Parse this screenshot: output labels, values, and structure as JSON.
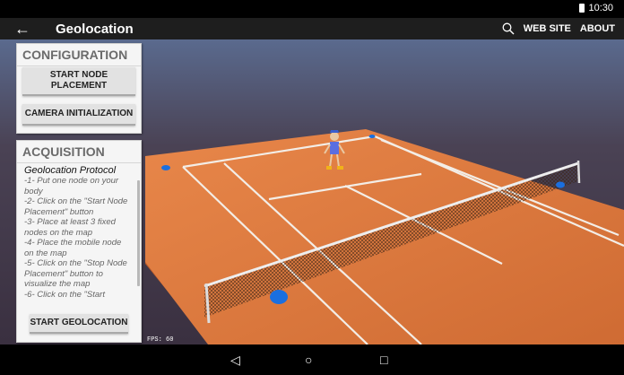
{
  "status_bar": {
    "time": "10:30"
  },
  "app_bar": {
    "back_icon": "arrow-back-icon",
    "title": "Geolocation",
    "search_icon": "search-icon",
    "website_label": "WEB SITE",
    "about_label": "ABOUT"
  },
  "configuration": {
    "title": "CONFIGURATION",
    "start_node_label": "START NODE PLACEMENT",
    "camera_label": "CAMERA INITIALIZATION"
  },
  "acquisition": {
    "title": "ACQUISITION",
    "protocol_title": "Geolocation Protocol",
    "steps": [
      "-1- Put one node on your body",
      "-2- Click on the \"Start Node Placement\" button",
      "-3- Place at least 3 fixed nodes on the map",
      "-4- Place the mobile node on the map",
      "-5- Click on the \"Stop Node Placement\" button to visualize the map",
      "-6- Click on the \"Start"
    ],
    "start_geo_label": "START GEOLOCATION"
  },
  "scene": {
    "fps_label": "FPS: 60",
    "court_color": "#d9763d",
    "node_color": "#1a6fe0"
  },
  "nav_bar": {
    "back": "◁",
    "home": "○",
    "recents": "□"
  }
}
